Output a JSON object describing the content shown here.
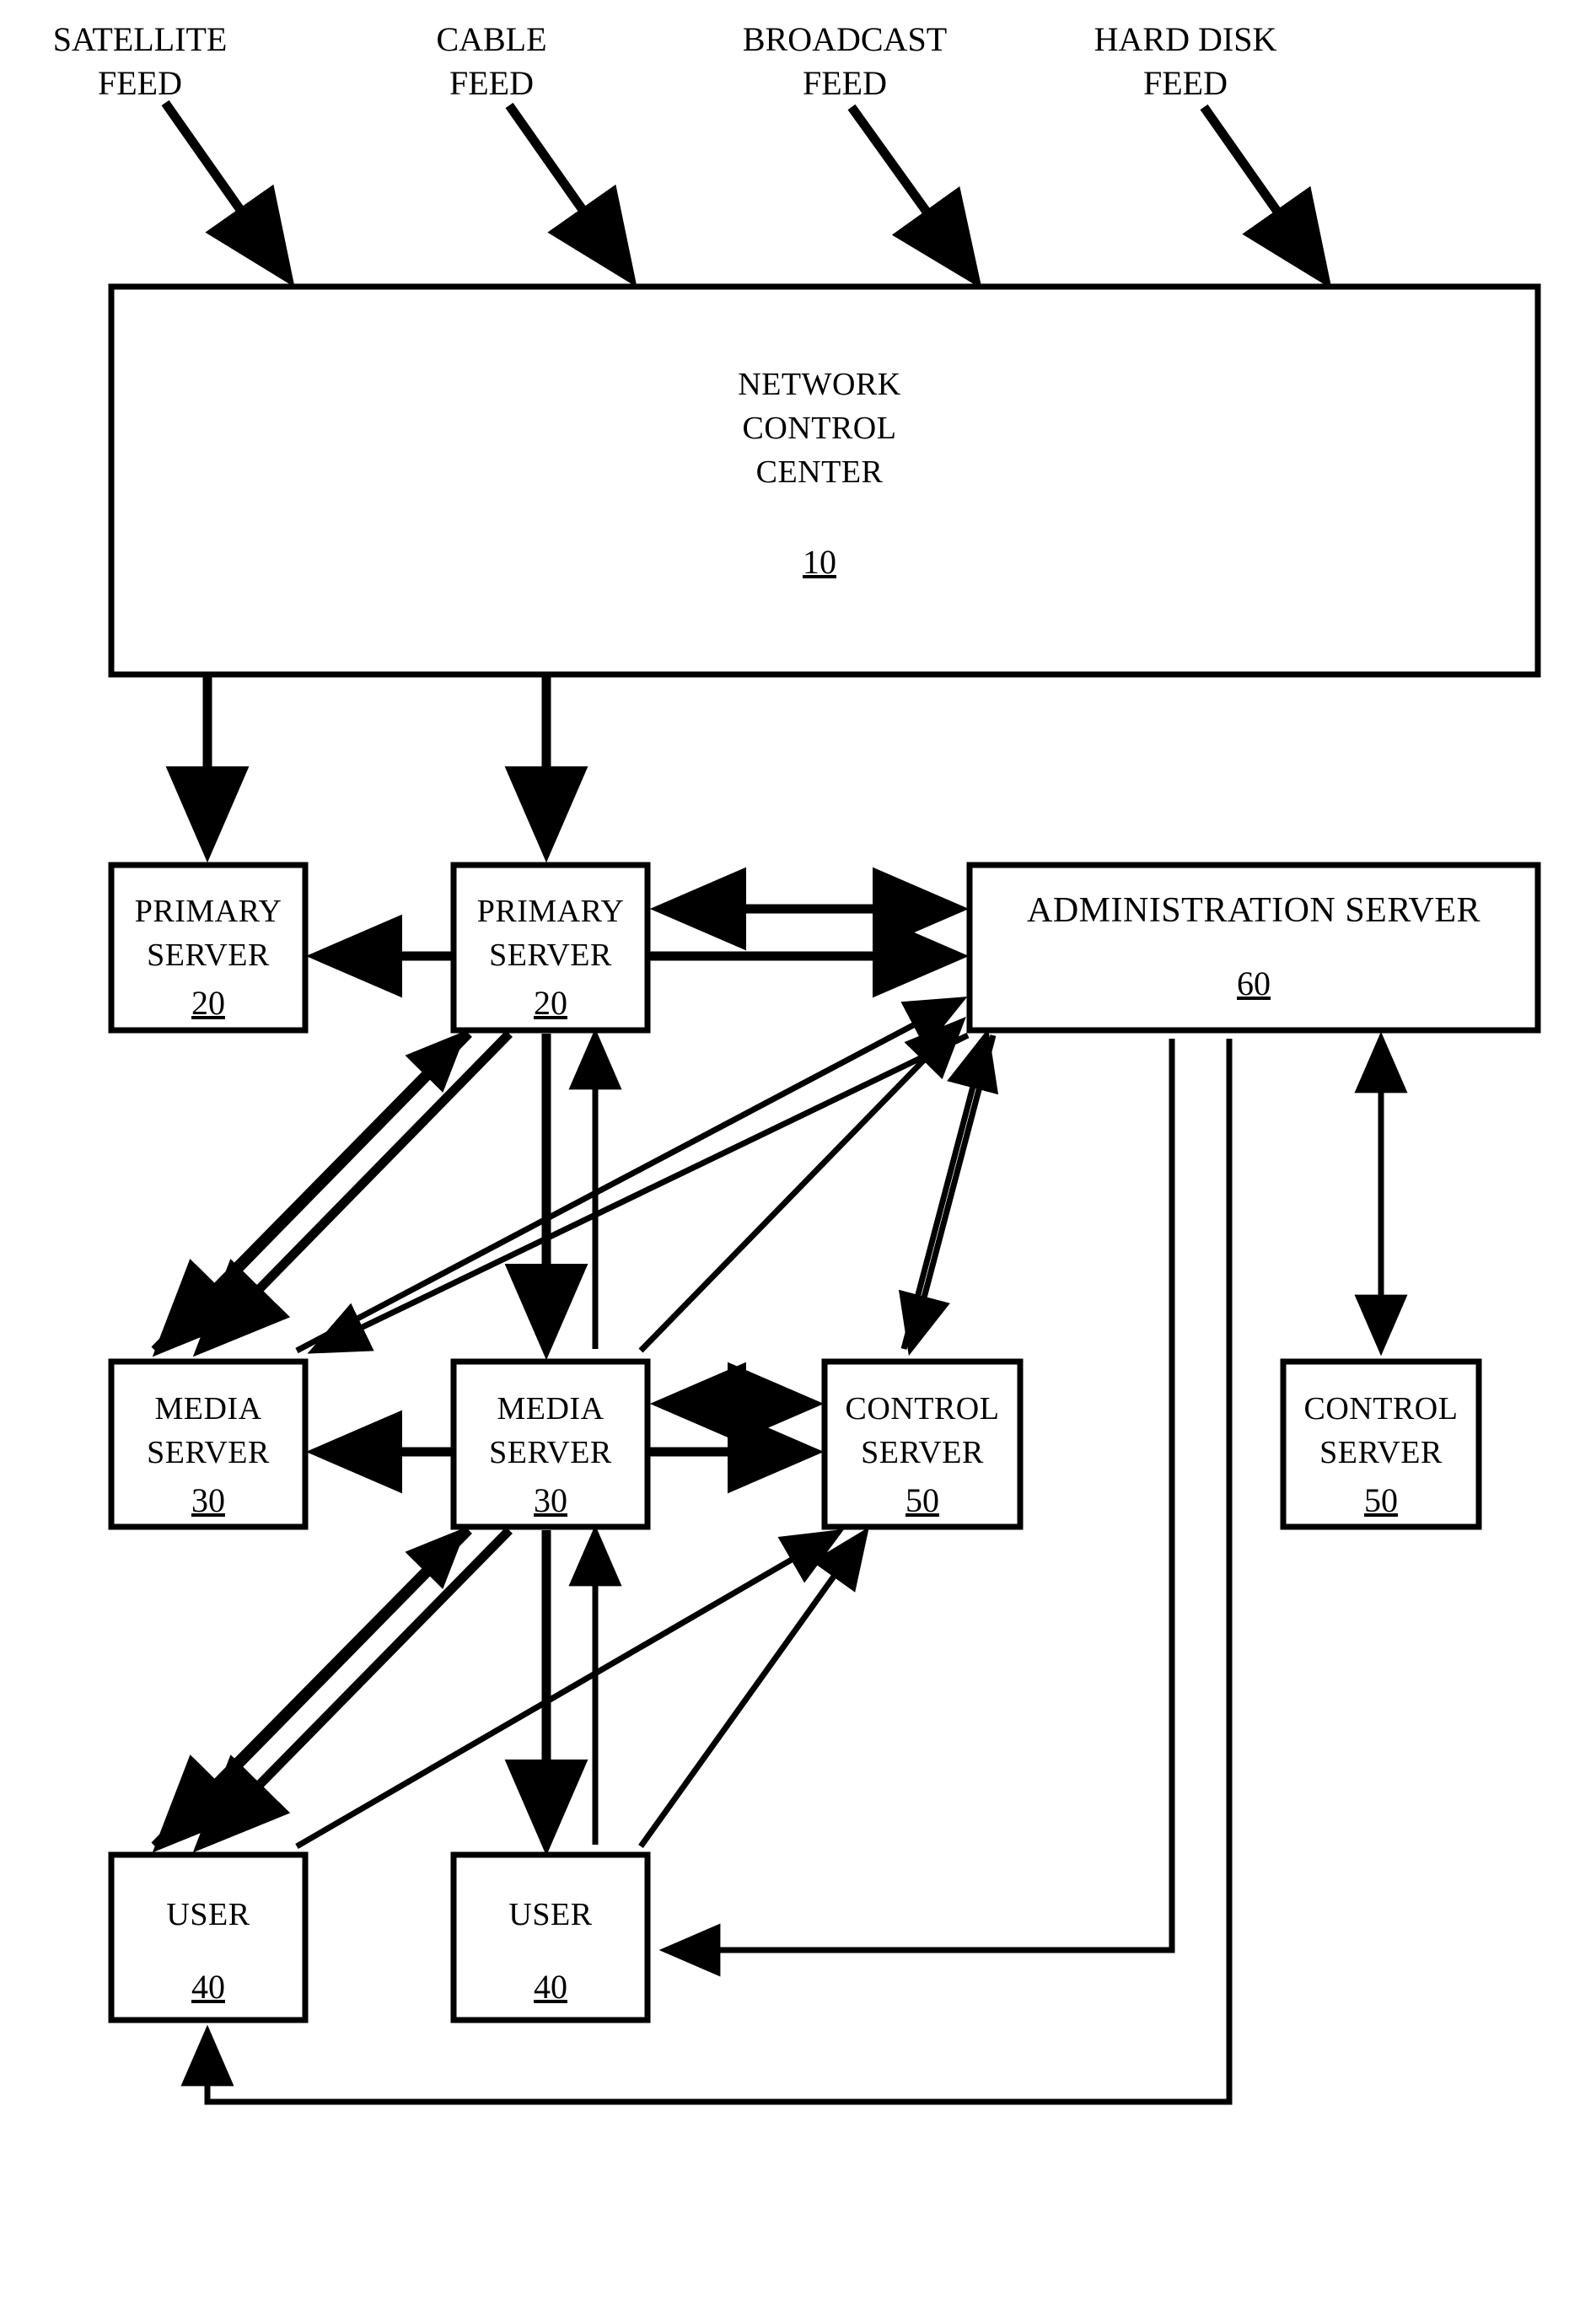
{
  "figure": {
    "type": "patent-block-diagram",
    "background_color": "#ffffff",
    "line_color": "#000000"
  },
  "feeds": [
    {
      "name": "satellite-feed",
      "line1": "SATELLITE",
      "line2": "FEED"
    },
    {
      "name": "cable-feed",
      "line1": "CABLE",
      "line2": "FEED"
    },
    {
      "name": "broadcast-feed",
      "line1": "BROADCAST",
      "line2": "FEED"
    },
    {
      "name": "hard-disk-feed",
      "line1": "HARD DISK",
      "line2": "FEED"
    }
  ],
  "nodes": {
    "network_control_center": {
      "line1": "NETWORK",
      "line2": "CONTROL",
      "line3": "CENTER",
      "ref": "10"
    },
    "primary_server_1": {
      "line1": "PRIMARY",
      "line2": "SERVER",
      "ref": "20"
    },
    "primary_server_2": {
      "line1": "PRIMARY",
      "line2": "SERVER",
      "ref": "20"
    },
    "administration_server": {
      "line1": "ADMINISTRATION SERVER",
      "ref": "60"
    },
    "media_server_1": {
      "line1": "MEDIA",
      "line2": "SERVER",
      "ref": "30"
    },
    "media_server_2": {
      "line1": "MEDIA",
      "line2": "SERVER",
      "ref": "30"
    },
    "control_server_1": {
      "line1": "CONTROL",
      "line2": "SERVER",
      "ref": "50"
    },
    "control_server_2": {
      "line1": "CONTROL",
      "line2": "SERVER",
      "ref": "50"
    },
    "user_1": {
      "line1": "USER",
      "ref": "40"
    },
    "user_2": {
      "line1": "USER",
      "ref": "40"
    }
  }
}
